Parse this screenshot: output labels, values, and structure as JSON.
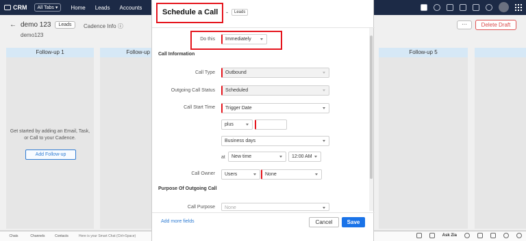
{
  "topbar": {
    "app_name": "CRM",
    "all_tabs": "All Tabs",
    "tabs": [
      "Home",
      "Leads",
      "Accounts",
      "C"
    ]
  },
  "background": {
    "record_name": "demo 123",
    "module_badge": "Leads",
    "cadence_info": "Cadence Info ⓘ",
    "record_sub": "demo123",
    "more_label": "···",
    "delete_label": "Delete Draft",
    "columns": [
      {
        "title": "Follow-up 1"
      },
      {
        "title": "Follow-up"
      },
      {
        "title": "Follow-up 5"
      }
    ],
    "empty_text_line1": "Get started by adding an Email, Task,",
    "empty_text_line2": "or Call to your Cadence.",
    "add_followup": "Add Follow-up"
  },
  "bottombar": {
    "items": [
      "Chats",
      "Channels",
      "Contacts"
    ],
    "chat_placeholder": "Here is your Smart Chat (Ctrl+Space)",
    "ask_zia": "Ask Zia"
  },
  "modal": {
    "title": "Schedule a Call",
    "dash": "-",
    "badge": "Leads",
    "do_this_label": "Do this",
    "do_this_value": "Immediately",
    "section_call_info": "Call Information",
    "call_type_label": "Call Type",
    "call_type_value": "Outbound",
    "call_status_label": "Outgoing Call Status",
    "call_status_value": "Scheduled",
    "start_time_label": "Call Start Time",
    "start_time_value": "Trigger Date",
    "offset_value": "plus",
    "offset_number": "",
    "unit_value": "Business days",
    "at_label": "at",
    "time_mode_value": "New time",
    "time_value": "12:00 AM",
    "owner_label": "Call Owner",
    "owner_type_value": "Users",
    "owner_value": "None",
    "section_purpose": "Purpose Of Outgoing Call",
    "purpose_label": "Call Purpose",
    "purpose_value": "None",
    "add_more_fields": "Add more fields",
    "cancel": "Cancel",
    "save": "Save"
  },
  "colors": {
    "accent": "#1a73e8",
    "highlight": "#e5141c",
    "topbar": "#1c2a46"
  }
}
